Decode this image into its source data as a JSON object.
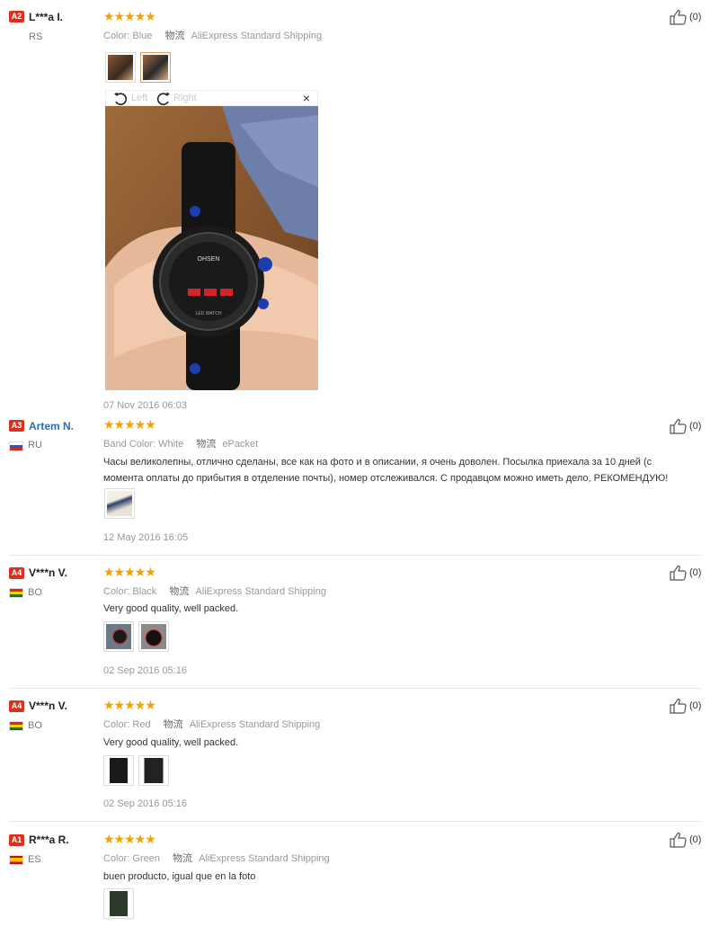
{
  "reviews": [
    {
      "rank": "A2",
      "name": "L***a I.",
      "country": "RS",
      "attr_key": "Color:",
      "attr_val": "Blue",
      "ship_key": "物流",
      "ship_val": "AliExpress Standard Shipping",
      "stars": "★★★★★",
      "date": "07 Nov 2016 06:03",
      "likes": "(0)"
    },
    {
      "rank": "A3",
      "name": "Artem N.",
      "country": "RU",
      "attr_key": "Band Color:",
      "attr_val": "White",
      "ship_key": "物流",
      "ship_val": "ePacket",
      "stars": "★★★★★",
      "text": "Часы великолепны, отлично сделаны, все как на фото и в описании, я очень доволен. Посылка приехала за 10 дней (с момента оплаты до прибытия в отделение почты), номер отслеживался. С продавцом можно иметь дело, РЕКОМЕНДУЮ!",
      "date": "12 May 2016 16:05",
      "likes": "(0)"
    },
    {
      "rank": "A4",
      "name": "V***n V.",
      "country": "BO",
      "attr_key": "Color:",
      "attr_val": "Black",
      "ship_key": "物流",
      "ship_val": "AliExpress Standard Shipping",
      "stars": "★★★★★",
      "text": "Very good quality, well packed.",
      "date": "02 Sep 2016 05:16",
      "likes": "(0)"
    },
    {
      "rank": "A4",
      "name": "V***n V.",
      "country": "BO",
      "attr_key": "Color:",
      "attr_val": "Red",
      "ship_key": "物流",
      "ship_val": "AliExpress Standard Shipping",
      "stars": "★★★★★",
      "text": "Very good quality, well packed.",
      "date": "02 Sep 2016 05:16",
      "likes": "(0)"
    },
    {
      "rank": "A1",
      "name": "R***a R.",
      "country": "ES",
      "attr_key": "Color:",
      "attr_val": "Green",
      "ship_key": "物流",
      "ship_val": "AliExpress Standard Shipping",
      "stars": "★★★★★",
      "text": "buen producto, igual que en la foto",
      "likes": "(0)"
    }
  ],
  "viewer": {
    "rotate_left": "Left",
    "rotate_right": "Right",
    "close": "×",
    "watch_brand": "OHSEN",
    "watch_sub": "LED WATCH"
  },
  "colors": {
    "star": "#f5a000",
    "badge": "#d9311f",
    "link": "#2a6ebb"
  }
}
